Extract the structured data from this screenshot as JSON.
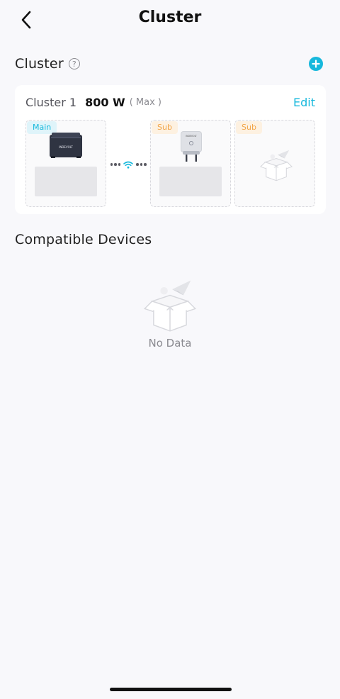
{
  "header": {
    "title": "Cluster",
    "back_icon": "chevron-left-icon"
  },
  "cluster_section": {
    "title": "Cluster",
    "help_icon": "question-icon",
    "add_icon": "plus-circle-icon",
    "accent_color": "#17b8dc"
  },
  "cluster_card": {
    "name": "Cluster 1",
    "power": "800 W",
    "max_label": "( Max )",
    "edit_label": "Edit",
    "slots": [
      {
        "tag": "Main",
        "device": "power-station-icon"
      },
      {
        "tag": "Sub",
        "device": "smart-plug-icon"
      },
      {
        "tag": "Sub",
        "device": "empty-box-icon"
      }
    ],
    "connector_icon": "wifi-icon"
  },
  "compatible_section": {
    "title": "Compatible Devices",
    "empty_text": "No Data",
    "empty_icon": "empty-box-icon"
  },
  "colors": {
    "main_tag": "#17b8dc",
    "sub_tag": "#f2a548"
  }
}
